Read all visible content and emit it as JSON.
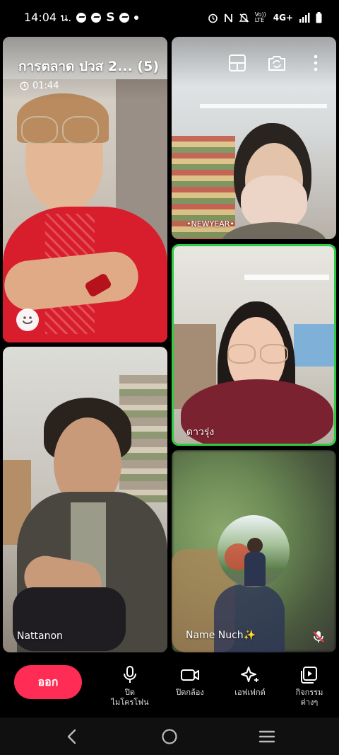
{
  "status_bar": {
    "time": "14:04 น.",
    "network": "4G+",
    "volte": "Vo)) LTE"
  },
  "call": {
    "group_title": "การตลาด ปวส 2... (5)",
    "duration": "01:44"
  },
  "participants": [
    {
      "name": "",
      "tile": "top-left"
    },
    {
      "name": "•NEWYEAR•",
      "tile": "top-right"
    },
    {
      "name": "ดาวรุ่ง",
      "tile": "middle-right",
      "speaking": true
    },
    {
      "name": "Nattanon",
      "tile": "bottom-left"
    },
    {
      "name": "Name Nuch✨",
      "tile": "bottom-right",
      "muted": true
    }
  ],
  "controls": {
    "leave": "ออก",
    "mic": "ปิด\nไมโครโฟน",
    "camera": "ปิดกล้อง",
    "effects": "เอฟเฟกต์",
    "activities": "กิจกรรม\nต่างๆ"
  },
  "colors": {
    "leave_button": "#ff2d55",
    "speaking_border": "#2ecc40"
  }
}
